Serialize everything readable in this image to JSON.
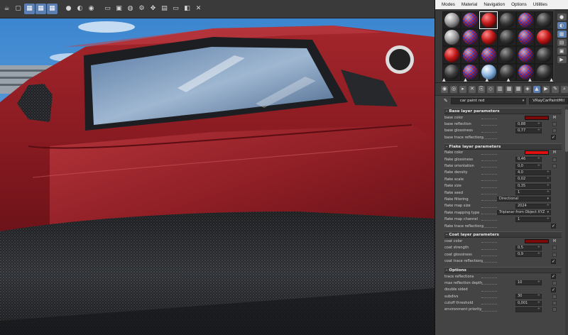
{
  "toolbar": {
    "buttons": [
      {
        "icon": "teapot-icon",
        "glyph": "☕",
        "active": false
      },
      {
        "icon": "render-region-icon",
        "glyph": "▢",
        "active": false
      },
      {
        "icon": "grid-icon",
        "glyph": "▦",
        "active": true
      },
      {
        "icon": "grid-icon",
        "glyph": "▦",
        "active": true
      },
      {
        "icon": "grid-icon",
        "glyph": "▦",
        "active": true
      },
      {
        "icon": "sphere-icon",
        "glyph": "●",
        "active": false
      },
      {
        "icon": "sphere-icon",
        "glyph": "◐",
        "active": false
      },
      {
        "icon": "sphere-icon",
        "glyph": "◉",
        "active": false
      },
      {
        "icon": "folder-icon",
        "glyph": "▭",
        "active": false
      },
      {
        "icon": "save-icon",
        "glyph": "▣",
        "active": false
      },
      {
        "icon": "render-icon",
        "glyph": "◍",
        "active": false
      },
      {
        "icon": "settings-icon",
        "glyph": "⚙",
        "active": false
      },
      {
        "icon": "move-icon",
        "glyph": "✥",
        "active": false
      },
      {
        "icon": "image-icon",
        "glyph": "▤",
        "active": false
      },
      {
        "icon": "monitor-icon",
        "glyph": "▭",
        "active": false
      },
      {
        "icon": "swatch-icon",
        "glyph": "◧",
        "active": false
      },
      {
        "icon": "close-icon",
        "glyph": "✕",
        "active": false
      }
    ]
  },
  "editor": {
    "menu": [
      "Modes",
      "Material",
      "Navigation",
      "Options",
      "Utilities"
    ],
    "slots": [
      {
        "type": "sphere-gray"
      },
      {
        "type": "sphere-checker"
      },
      {
        "type": "sphere-red"
      },
      {
        "type": "sphere-dark"
      },
      {
        "type": "sphere-checker"
      },
      {
        "type": "sphere-dark"
      },
      {
        "type": "sphere-gray"
      },
      {
        "type": "sphere-checker"
      },
      {
        "type": "sphere-red"
      },
      {
        "type": "sphere-dark"
      },
      {
        "type": "sphere-checker"
      },
      {
        "type": "sphere-red"
      },
      {
        "type": "sphere-red"
      },
      {
        "type": "sphere-checker"
      },
      {
        "type": "sphere-checker"
      },
      {
        "type": "sphere-dark"
      },
      {
        "type": "sphere-checker"
      },
      {
        "type": "sphere-dark"
      },
      {
        "type": "sphere-dark"
      },
      {
        "type": "sphere-checker"
      },
      {
        "type": "sphere-sky"
      },
      {
        "type": "sphere-dark"
      },
      {
        "type": "sphere-checker"
      },
      {
        "type": "sphere-dark"
      }
    ],
    "material_name": "car paint red",
    "material_type": "VRayCarPaintMtl",
    "colors": {
      "base": "#7a0a0a",
      "flake": "#e01010",
      "coat": "#7a0a0a",
      "accent": "#5b7fb3"
    },
    "rollouts": [
      {
        "title": "Base layer parameters",
        "params": [
          {
            "label": "base color",
            "kind": "color",
            "color_key": "base"
          },
          {
            "label": "base reflection",
            "kind": "spinner",
            "value": "0,88"
          },
          {
            "label": "base glossiness",
            "kind": "spinner",
            "value": "0,77"
          },
          {
            "label": "base trace reflections",
            "kind": "check",
            "value": "✓"
          }
        ]
      },
      {
        "title": "Flake layer parameters",
        "params": [
          {
            "label": "flake color",
            "kind": "color",
            "color_key": "flake"
          },
          {
            "label": "flake glossiness",
            "kind": "spinner",
            "value": "0,46"
          },
          {
            "label": "flake orientation",
            "kind": "spinner",
            "value": "0,0"
          },
          {
            "label": "flake density",
            "kind": "spinner-wide",
            "value": "4,0"
          },
          {
            "label": "flake scale",
            "kind": "spinner-wide",
            "value": "0,02"
          },
          {
            "label": "flake size",
            "kind": "spinner-wide",
            "value": "0,35"
          },
          {
            "label": "flake seed",
            "kind": "spinner-wide",
            "value": "1"
          },
          {
            "label": "flake filtering",
            "kind": "dropdown",
            "value": "Directional"
          },
          {
            "label": "flake map size",
            "kind": "spinner-wide",
            "value": "2024"
          },
          {
            "label": "flake mapping type",
            "kind": "dropdown",
            "value": "Triplanar from Object XYZ"
          },
          {
            "label": "flake map channel",
            "kind": "spinner-wide",
            "value": "1"
          },
          {
            "label": "flake trace reflections",
            "kind": "check",
            "value": "✓"
          }
        ]
      },
      {
        "title": "Coat layer parameters",
        "params": [
          {
            "label": "coat color",
            "kind": "color",
            "color_key": "coat"
          },
          {
            "label": "coat strength",
            "kind": "spinner",
            "value": "0,5"
          },
          {
            "label": "coat glossiness",
            "kind": "spinner",
            "value": "0,9"
          },
          {
            "label": "coat trace reflections",
            "kind": "check",
            "value": "✓"
          }
        ]
      },
      {
        "title": "Options",
        "params": [
          {
            "label": "trace reflections",
            "kind": "check",
            "value": "✓"
          },
          {
            "label": "max reflection depth",
            "kind": "spinner",
            "value": "10"
          },
          {
            "label": "double sided",
            "kind": "check",
            "value": "✓"
          },
          {
            "label": "subdivs",
            "kind": "spinner",
            "value": "30"
          },
          {
            "label": "cutoff threshold",
            "kind": "spinner",
            "value": "0,001"
          },
          {
            "label": "environment priority",
            "kind": "spinner",
            "value": ""
          }
        ]
      }
    ]
  }
}
